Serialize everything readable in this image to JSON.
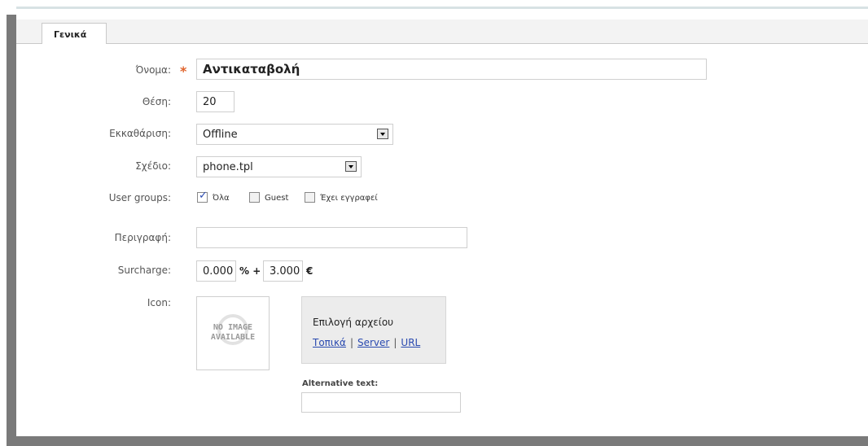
{
  "tabs": [
    {
      "label": "Γενικά"
    }
  ],
  "form": {
    "name": {
      "label": "Όνομα:",
      "value": "Αντικαταβολή",
      "required_mark": "*"
    },
    "position": {
      "label": "Θέση:",
      "value": "20"
    },
    "processor": {
      "label": "Εκκαθάριση:",
      "value": "Offline"
    },
    "template": {
      "label": "Σχέδιο:",
      "value": "phone.tpl"
    },
    "user_groups": {
      "label": "User groups:",
      "options": [
        {
          "label": "Όλα",
          "checked": true
        },
        {
          "label": "Guest",
          "checked": false
        },
        {
          "label": "Έχει εγγραφεί",
          "checked": false
        }
      ]
    },
    "description": {
      "label": "Περιγραφή:",
      "value": ""
    },
    "surcharge": {
      "label": "Surcharge:",
      "percent_value": "0.000",
      "percent_symbol": "% +",
      "fixed_value": "3.000",
      "currency": "€"
    },
    "icon": {
      "label": "Icon:",
      "placeholder_text_line1": "NO IMAGE",
      "placeholder_text_line2": "AVAILABLE",
      "file_select_title": "Επιλογή αρχείου",
      "links": [
        "Τοπικά",
        "Server",
        "URL"
      ],
      "alt_label": "Alternative text:",
      "alt_value": ""
    }
  },
  "colors": {
    "required": "#e0622a",
    "link": "#2a4ab0",
    "frame": "#7a7a7a"
  }
}
